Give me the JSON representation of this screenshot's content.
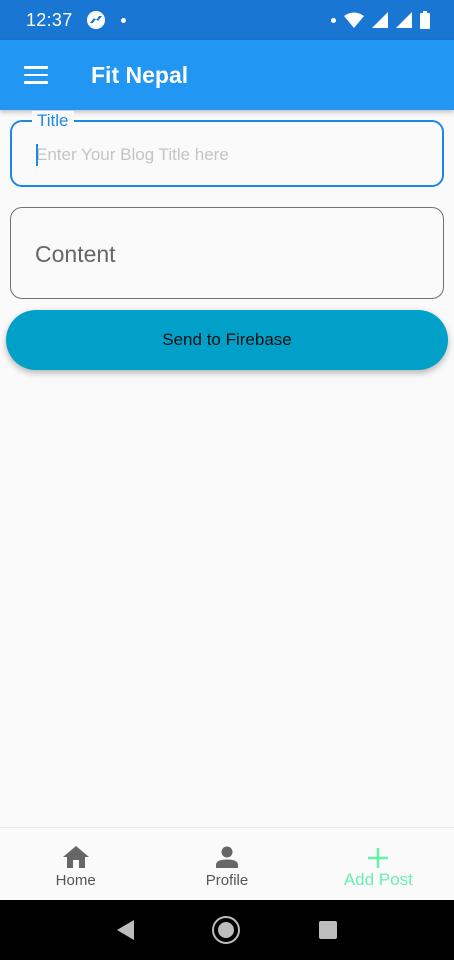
{
  "status_bar": {
    "time": "12:37",
    "icons": [
      "messenger-icon",
      "notification-dot-icon",
      "wifi-icon",
      "signal-icon",
      "signal-icon",
      "battery-icon"
    ]
  },
  "app_bar": {
    "title": "Fit Nepal",
    "menu_icon": "hamburger-menu-icon"
  },
  "form": {
    "title_label": "Title",
    "title_placeholder": "Enter Your Blog Title here",
    "title_value": "",
    "content_placeholder": "Content",
    "content_value": "",
    "send_label": "Send to Firebase"
  },
  "bottom_nav": {
    "items": [
      {
        "label": "Home",
        "icon": "home-icon",
        "active": false
      },
      {
        "label": "Profile",
        "icon": "person-icon",
        "active": false
      },
      {
        "label": "Add Post",
        "icon": "plus-icon",
        "active": true
      }
    ]
  },
  "colors": {
    "status_bar": "#1976d2",
    "app_bar": "#2196f3",
    "focus_border": "#1e88e5",
    "button": "#00a0c8",
    "active_nav": "#69f0ae",
    "background": "#fafafa"
  }
}
